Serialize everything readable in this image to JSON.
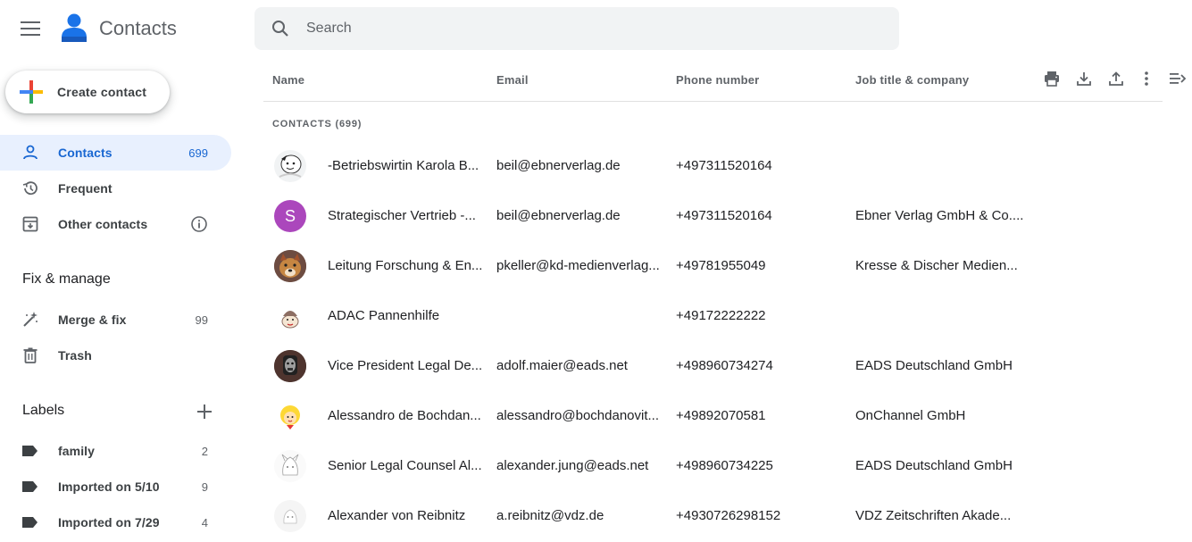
{
  "header": {
    "app_title": "Contacts",
    "search_placeholder": "Search"
  },
  "sidebar": {
    "create_label": "Create contact",
    "nav": [
      {
        "label": "Contacts",
        "count": "699",
        "icon": "person-icon",
        "active": true
      },
      {
        "label": "Frequent",
        "count": "",
        "icon": "history-icon"
      },
      {
        "label": "Other contacts",
        "count": "",
        "icon": "archive-icon"
      }
    ],
    "fix_title": "Fix & manage",
    "fix_items": [
      {
        "label": "Merge & fix",
        "count": "99",
        "icon": "magic-wand-icon"
      },
      {
        "label": "Trash",
        "count": "",
        "icon": "trash-icon"
      }
    ],
    "labels_title": "Labels",
    "labels": [
      {
        "label": "family",
        "count": "2"
      },
      {
        "label": "Imported on 5/10",
        "count": "9"
      },
      {
        "label": "Imported on 7/29",
        "count": "4"
      }
    ]
  },
  "table": {
    "columns": {
      "name": "Name",
      "email": "Email",
      "phone": "Phone number",
      "job": "Job title & company"
    },
    "section_label": "CONTACTS (699)",
    "rows": [
      {
        "name": "-Betriebswirtin Karola B...",
        "email": "beil@ebnerverlag.de",
        "phone": "+497311520164",
        "job": ""
      },
      {
        "name": "Strategischer Vertrieb -...",
        "email": "beil@ebnerverlag.de",
        "phone": "+497311520164",
        "job": "Ebner Verlag GmbH & Co....",
        "initial": "S"
      },
      {
        "name": "Leitung Forschung & En...",
        "email": "pkeller@kd-medienverlag...",
        "phone": "+49781955049",
        "job": "Kresse & Discher Medien..."
      },
      {
        "name": "ADAC Pannenhilfe",
        "email": "",
        "phone": "+49172222222",
        "job": ""
      },
      {
        "name": "Vice President Legal De...",
        "email": "adolf.maier@eads.net",
        "phone": "+498960734274",
        "job": "EADS Deutschland GmbH"
      },
      {
        "name": "Alessandro de Bochdan...",
        "email": "alessandro@bochdanovit...",
        "phone": "+49892070581",
        "job": "OnChannel GmbH"
      },
      {
        "name": "Senior Legal Counsel Al...",
        "email": "alexander.jung@eads.net",
        "phone": "+498960734225",
        "job": "EADS Deutschland GmbH"
      },
      {
        "name": "Alexander von Reibnitz",
        "email": "a.reibnitz@vdz.de",
        "phone": "+4930726298152",
        "job": "VDZ Zeitschriften Akade..."
      }
    ]
  },
  "colors": {
    "accent": "#1967d2",
    "active_bg": "#e8f0fe",
    "avatar_purple": "#ab47bc"
  }
}
